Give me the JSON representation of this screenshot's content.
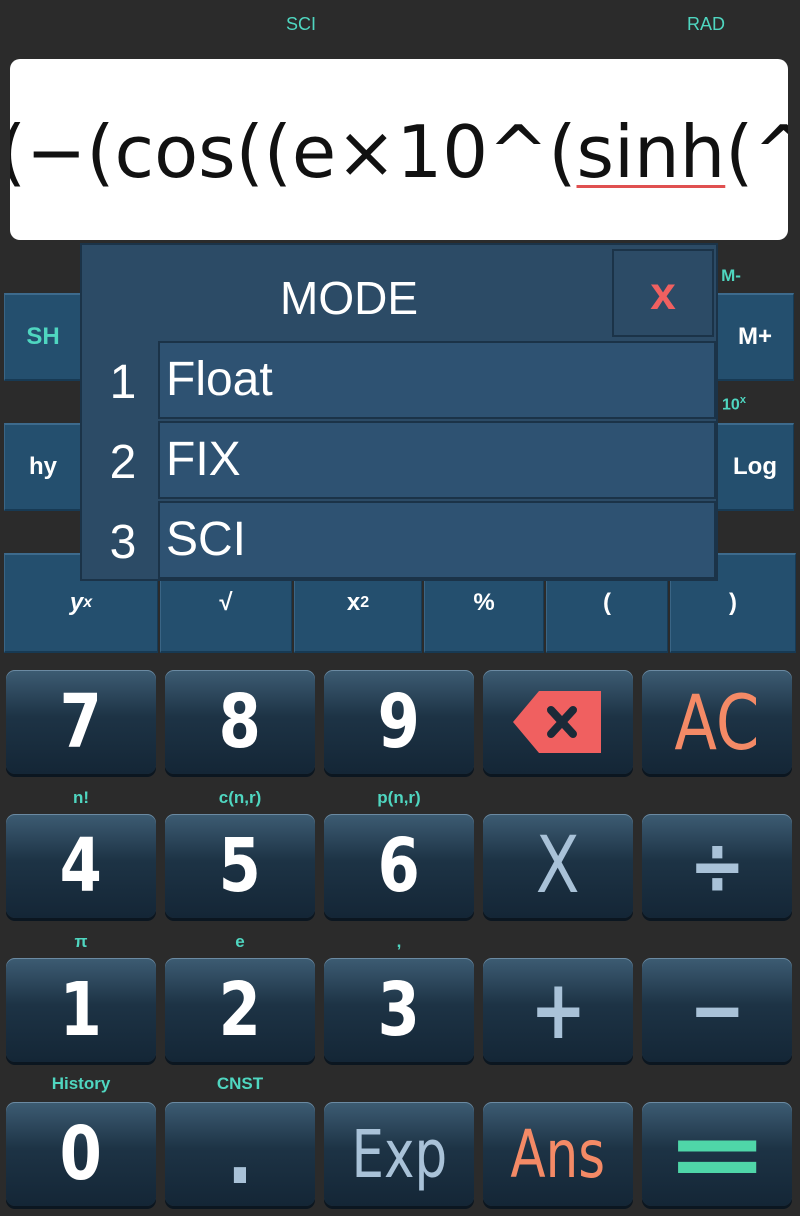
{
  "status": {
    "mode": "SCI",
    "angle": "RAD"
  },
  "display": {
    "pre": "(−(cos((e×10^(",
    "underlined": "sinh",
    "post": "(^(+"
  },
  "fn_row1": {
    "left": "SH",
    "right": "M+",
    "right_top": "M-"
  },
  "fn_row2": {
    "left": "hy",
    "right": "Log",
    "right_top": "10x"
  },
  "fn_row3": [
    "yx",
    "√",
    "x2",
    "%",
    "(",
    ")"
  ],
  "dialog": {
    "title": "MODE",
    "close": "x",
    "options": [
      {
        "num": "1",
        "label": "Float"
      },
      {
        "num": "2",
        "label": "FIX"
      },
      {
        "num": "3",
        "label": "SCI"
      }
    ]
  },
  "keys": {
    "row1": [
      "7",
      "8",
      "9",
      "⌫",
      "AC"
    ],
    "row2_labels": [
      "n!",
      "c(n,r)",
      "p(n,r)"
    ],
    "row2": [
      "4",
      "5",
      "6",
      "X",
      "÷"
    ],
    "row3_labels": [
      "π",
      "e",
      ","
    ],
    "row3": [
      "1",
      "2",
      "3",
      "+",
      "−"
    ],
    "row4_labels": [
      "History",
      "CNST"
    ],
    "row4": [
      "0",
      ".",
      "Exp",
      "Ans",
      "="
    ]
  },
  "colors": {
    "accent": "#4fd6c0",
    "ac": "#f48a66",
    "close": "#f06060",
    "equals": "#4fd6a8"
  }
}
